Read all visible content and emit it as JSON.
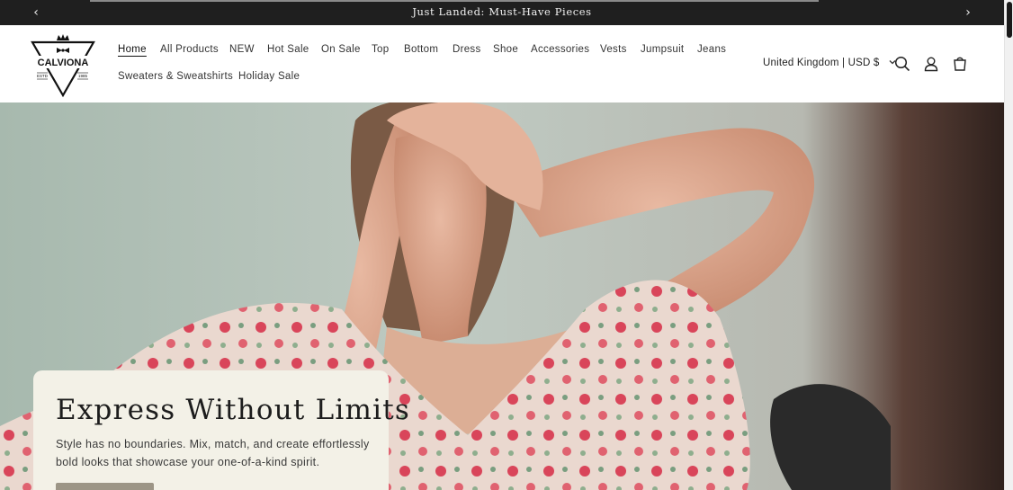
{
  "announcement": {
    "message": "Just Landed: Must-Have Pieces",
    "prev_icon": "chevron-left-icon",
    "next_icon": "chevron-right-icon"
  },
  "brand": {
    "name": "CALVIONA",
    "estd": "ESTD",
    "year": "1985"
  },
  "nav": {
    "items": [
      {
        "label": "Home",
        "active": true
      },
      {
        "label": "All Products"
      },
      {
        "label": "NEW"
      },
      {
        "label": "Hot Sale"
      },
      {
        "label": "On Sale"
      },
      {
        "label": "Top"
      },
      {
        "label": "Bottom"
      },
      {
        "label": "Dress"
      },
      {
        "label": "Shoe"
      },
      {
        "label": "Accessories"
      },
      {
        "label": "Vests"
      },
      {
        "label": "Jumpsuit"
      },
      {
        "label": "Jeans"
      },
      {
        "label": "Sweaters & Sweatshirts"
      },
      {
        "label": "Holiday Sale"
      }
    ]
  },
  "header_actions": {
    "locale": "United Kingdom | USD $",
    "icons": [
      "search-icon",
      "account-icon",
      "cart-icon"
    ]
  },
  "hero": {
    "heading": "Express Without Limits",
    "text": "Style has no boundaries. Mix, match, and create effortlessly bold looks that showcase your one-of-a-kind spirit."
  },
  "colors": {
    "announcement_bg": "#1f1f1f",
    "card_bg": "#f3f1e7",
    "button_bg": "#9c9586"
  }
}
